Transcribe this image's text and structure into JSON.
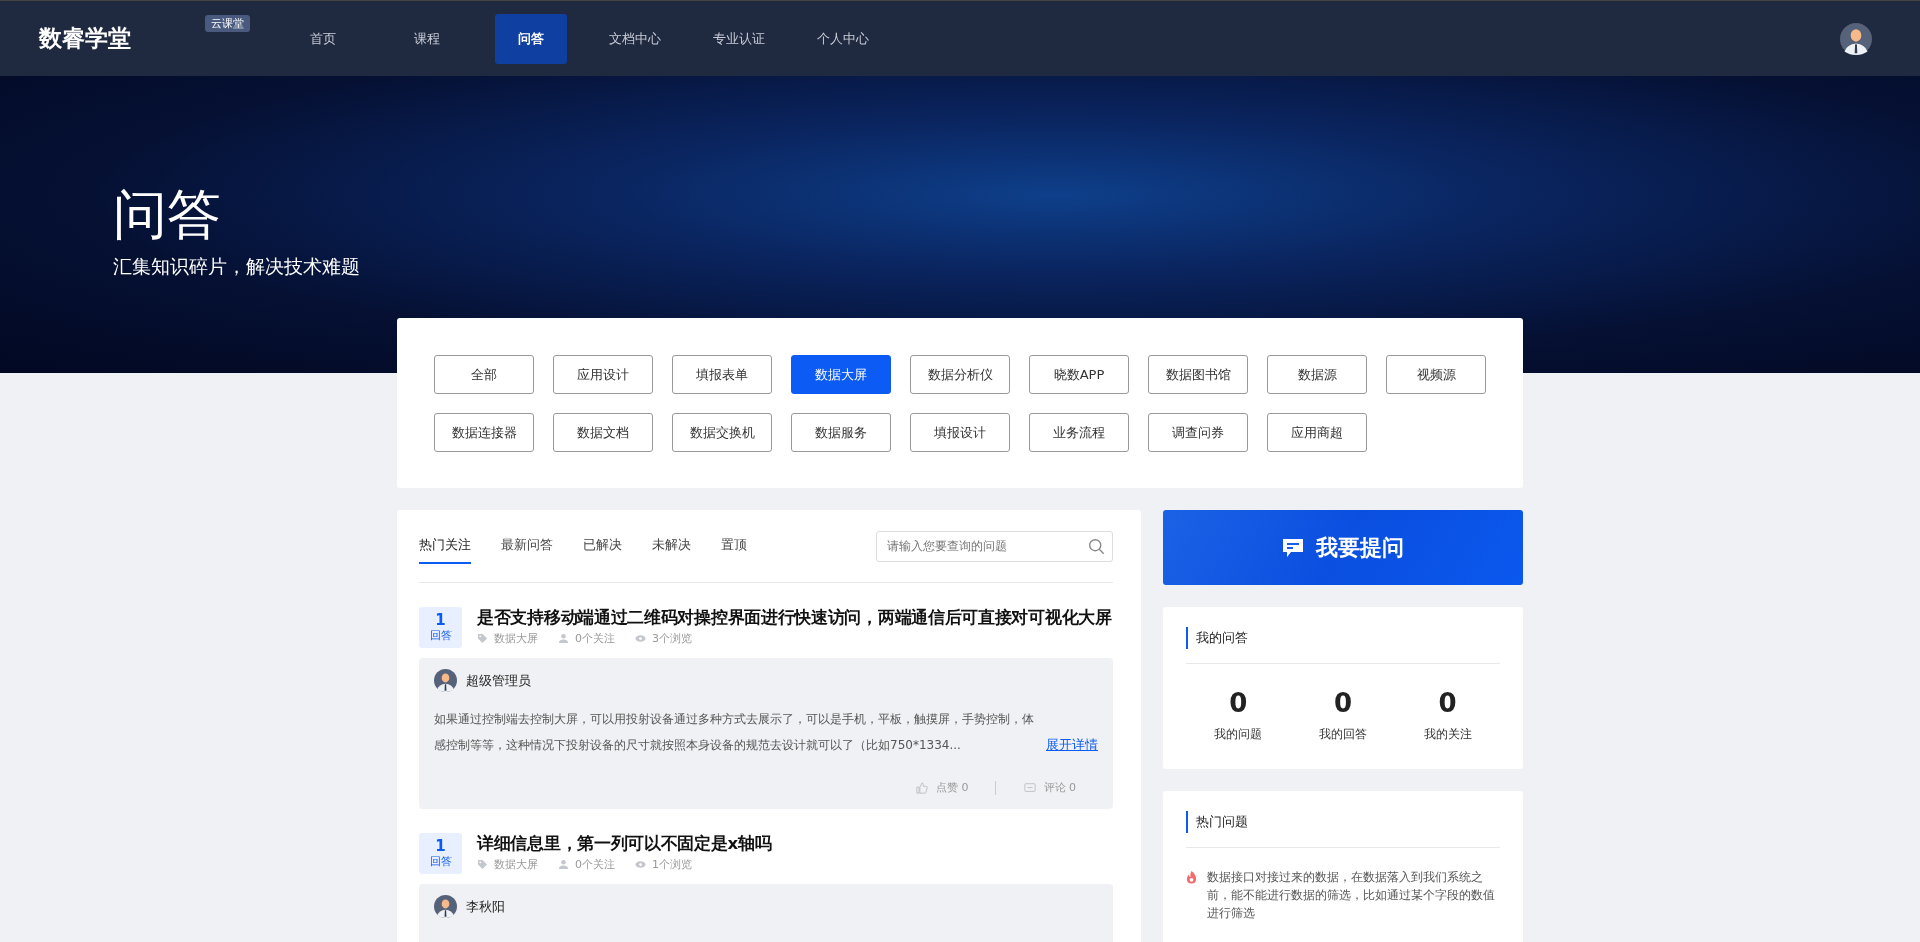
{
  "header": {
    "logo": "数睿学堂",
    "badge": "云课堂",
    "nav": [
      {
        "label": "首页",
        "selected": false
      },
      {
        "label": "课程",
        "selected": false
      },
      {
        "label": "问答",
        "selected": true
      },
      {
        "label": "文档中心",
        "selected": false
      },
      {
        "label": "专业认证",
        "selected": false
      },
      {
        "label": "个人中心",
        "selected": false
      }
    ]
  },
  "hero": {
    "title": "问答",
    "subtitle": "汇集知识碎片，解决技术难题"
  },
  "categories": [
    {
      "label": "全部",
      "selected": false
    },
    {
      "label": "应用设计",
      "selected": false
    },
    {
      "label": "填报表单",
      "selected": false
    },
    {
      "label": "数据大屏",
      "selected": true
    },
    {
      "label": "数据分析仪",
      "selected": false
    },
    {
      "label": "晓数APP",
      "selected": false
    },
    {
      "label": "数据图书馆",
      "selected": false
    },
    {
      "label": "数据源",
      "selected": false
    },
    {
      "label": "视频源",
      "selected": false
    },
    {
      "label": "数据连接器",
      "selected": false
    },
    {
      "label": "数据文档",
      "selected": false
    },
    {
      "label": "数据交换机",
      "selected": false
    },
    {
      "label": "数据服务",
      "selected": false
    },
    {
      "label": "填报设计",
      "selected": false
    },
    {
      "label": "业务流程",
      "selected": false
    },
    {
      "label": "调查问券",
      "selected": false
    },
    {
      "label": "应用商超",
      "selected": false
    }
  ],
  "tabs": [
    {
      "label": "热门关注",
      "selected": true
    },
    {
      "label": "最新问答",
      "selected": false
    },
    {
      "label": "已解决",
      "selected": false
    },
    {
      "label": "未解决",
      "selected": false
    },
    {
      "label": "置顶",
      "selected": false
    }
  ],
  "search": {
    "placeholder": "请输入您要查询的问题"
  },
  "questions": [
    {
      "answer_count": "1",
      "answer_label": "回答",
      "title": "是否支持移动端通过二维码对操控界面进行快速访问，两端通信后可直接对可视化大屏",
      "tag": "数据大屏",
      "follows": "0个关注",
      "views": "3个浏览",
      "answer": {
        "author": "超级管理员",
        "text": "如果通过控制端去控制大屏，可以用投射设备通过多种方式去展示了，可以是手机，平板，触摸屏，手势控制，体感控制等等，这种情况下投射设备的尺寸就按照本身设备的规范去设计就可以了（比如750*1334...",
        "expand": "展开详情",
        "likes": "点赞 0",
        "comments": "评论 0"
      }
    },
    {
      "answer_count": "1",
      "answer_label": "回答",
      "title": "详细信息里，第一列可以不固定是x轴吗",
      "tag": "数据大屏",
      "follows": "0个关注",
      "views": "1个浏览",
      "answer": {
        "author": "李秋阳"
      }
    }
  ],
  "ask_button": "我要提问",
  "my_qa": {
    "title": "我的问答",
    "stats": [
      {
        "value": "0",
        "label": "我的问题"
      },
      {
        "value": "0",
        "label": "我的回答"
      },
      {
        "value": "0",
        "label": "我的关注"
      }
    ]
  },
  "hot": {
    "title": "热门问题",
    "items": [
      "数据接口对接过来的数据，在数据落入到我们系统之前，能不能进行数据的筛选，比如通过某个字段的数值进行筛选"
    ]
  }
}
